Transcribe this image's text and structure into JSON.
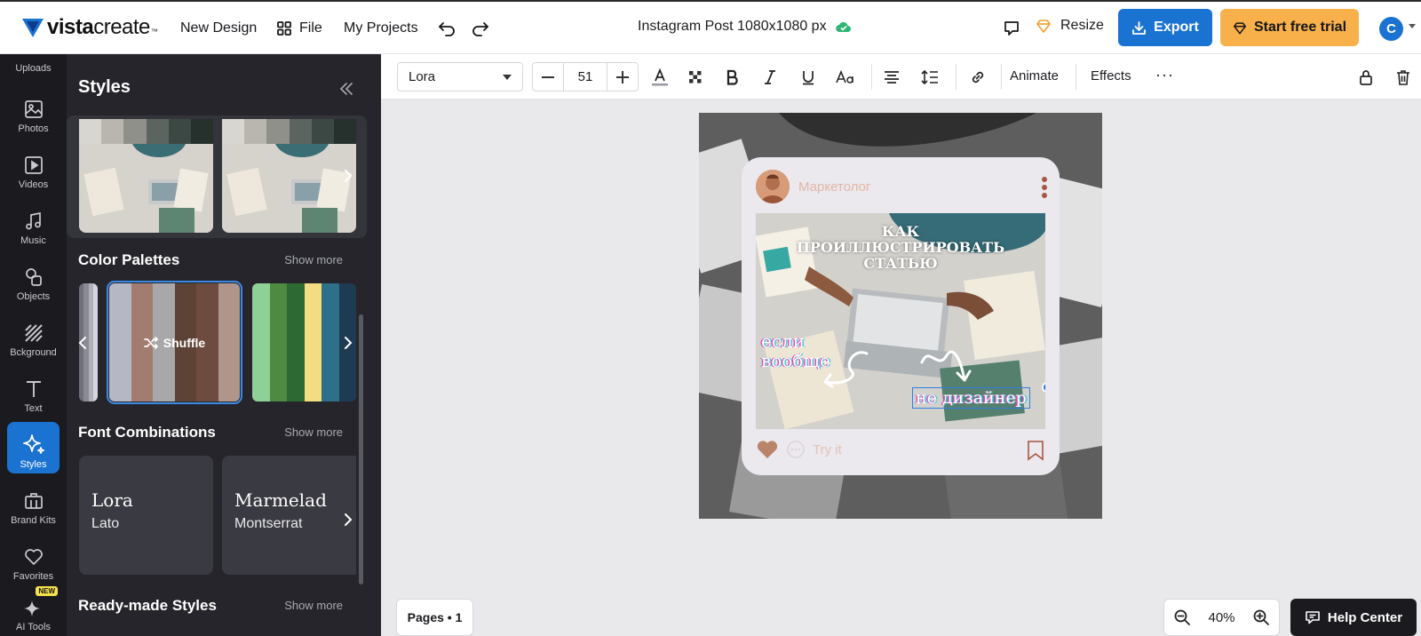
{
  "brand": {
    "logo_text": "vista",
    "logo_text2": "create",
    "logo_tm": "™"
  },
  "topnav": {
    "new_design": "New Design",
    "file": "File",
    "my_projects": "My Projects"
  },
  "doc": {
    "title": "Instagram Post 1080x1080 px",
    "saved_icon": "cloud-check-icon"
  },
  "actions": {
    "resize": "Resize",
    "export": "Export",
    "trial": "Start free trial",
    "avatar_initial": "C"
  },
  "rail": {
    "uploads": "Uploads",
    "items": [
      "Photos",
      "Videos",
      "Music",
      "Objects",
      "Bckground",
      "Text",
      "Styles",
      "Brand Kits",
      "Favorites",
      "AI Tools"
    ],
    "active": "Styles",
    "new_badge": "NEW"
  },
  "panel": {
    "title": "Styles",
    "color_palettes": "Color Palettes",
    "font_combinations": "Font Combinations",
    "ready_made": "Ready-made Styles",
    "show_more": "Show more",
    "shuffle": "Shuffle",
    "fonts": [
      {
        "primary": "Lora",
        "secondary": "Lato"
      },
      {
        "primary": "Marmelad",
        "secondary": "Montserrat"
      }
    ],
    "palettes": [
      [
        "#6e7079",
        "#8b8b95",
        "#b0b0bc",
        "#d5d5de"
      ],
      [
        "#b6b7c4",
        "#a47c6f",
        "#a8a7a9",
        "#5d4236",
        "#6d4c3f",
        "#b0958a"
      ],
      [
        "#8dd196",
        "#4e8a40",
        "#2d6a33",
        "#f4dc80",
        "#2e6f8a",
        "#1f3b52"
      ]
    ],
    "style_swatches": [
      [
        "#d8d6d0",
        "#b8b6ae",
        "#8f908a",
        "#5c6460",
        "#3c4844",
        "#26302d"
      ],
      [
        "#d8d6d0",
        "#b8b6ae",
        "#8f908a",
        "#5c6460",
        "#3c4844",
        "#26302d"
      ]
    ]
  },
  "toolbar": {
    "font": "Lora",
    "size": "51",
    "animate": "Animate",
    "effects": "Effects",
    "more": "···"
  },
  "post": {
    "username": "Маркетолог",
    "heading": [
      "КАК",
      "ПРОИЛЛЮСТРИРОВАТЬ",
      "СТАТЬЮ"
    ],
    "esli": [
      "если",
      "вообще"
    ],
    "ne_dizainer": "не дизайнер",
    "try_it": "Try it"
  },
  "bottom": {
    "pages": "Pages • 1",
    "zoom": "40%",
    "help": "Help Center"
  },
  "colors": {
    "accent": "#1a73d1",
    "trial": "#f8b04a",
    "panel": "#25252b",
    "rail": "#1b1b1f"
  }
}
